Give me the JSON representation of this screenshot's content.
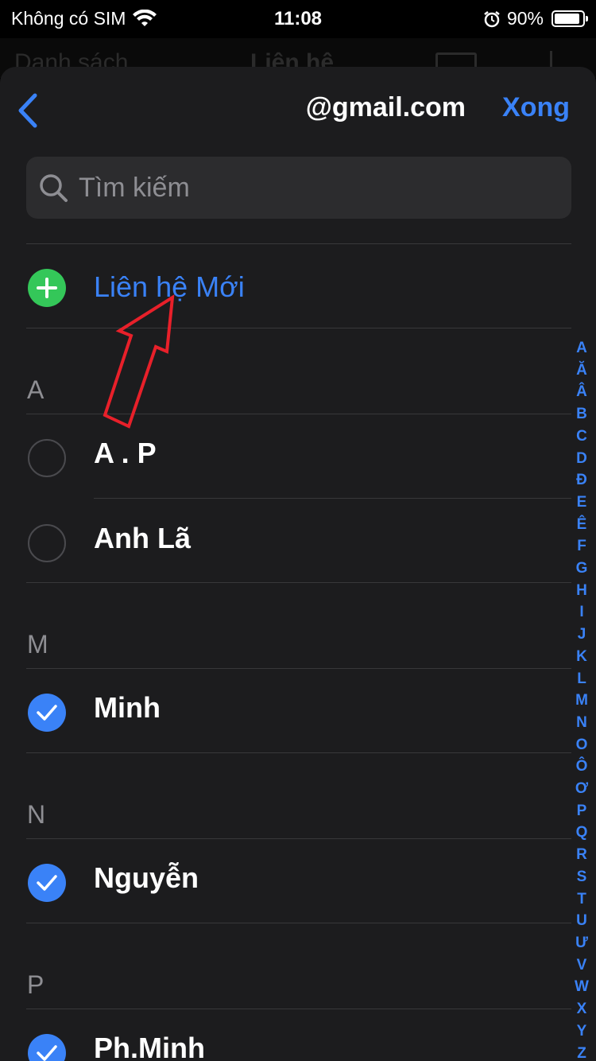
{
  "status_bar": {
    "carrier": "Không có SIM",
    "time": "11:08",
    "battery_percent": "90%",
    "battery_level": 0.9,
    "icons": [
      "wifi-icon",
      "alarm-icon",
      "battery-icon"
    ]
  },
  "background_nav": {
    "back_label": "Danh sách",
    "title": "Liên hệ"
  },
  "nav": {
    "title": "@gmail.com",
    "done_label": "Xong",
    "back_icon": "chevron-left-icon"
  },
  "search": {
    "placeholder": "Tìm kiếm",
    "value": ""
  },
  "new_contact": {
    "label": "Liên hệ Mới",
    "icon": "plus-circle-icon"
  },
  "sections": [
    {
      "header": "A",
      "contacts": [
        {
          "name": "A . P",
          "selected": false
        },
        {
          "name": "Anh Lã",
          "selected": false
        }
      ]
    },
    {
      "header": "M",
      "contacts": [
        {
          "name": "Minh",
          "selected": true
        }
      ]
    },
    {
      "header": "N",
      "contacts": [
        {
          "name": "Nguyễn",
          "selected": true
        }
      ]
    },
    {
      "header": "P",
      "contacts": [
        {
          "name": "Ph.Minh",
          "selected": true
        }
      ]
    }
  ],
  "index_letters": [
    "A",
    "Ă",
    "Â",
    "B",
    "C",
    "D",
    "Đ",
    "E",
    "Ê",
    "F",
    "G",
    "H",
    "I",
    "J",
    "K",
    "L",
    "M",
    "N",
    "O",
    "Ô",
    "Ơ",
    "P",
    "Q",
    "R",
    "S",
    "T",
    "U",
    "Ư",
    "V",
    "W",
    "X",
    "Y",
    "Z",
    "#"
  ],
  "colors": {
    "accent": "#3a82f7",
    "add_green": "#34c759",
    "sheet_background": "#1c1c1e",
    "annotation_red": "#e8202a"
  }
}
